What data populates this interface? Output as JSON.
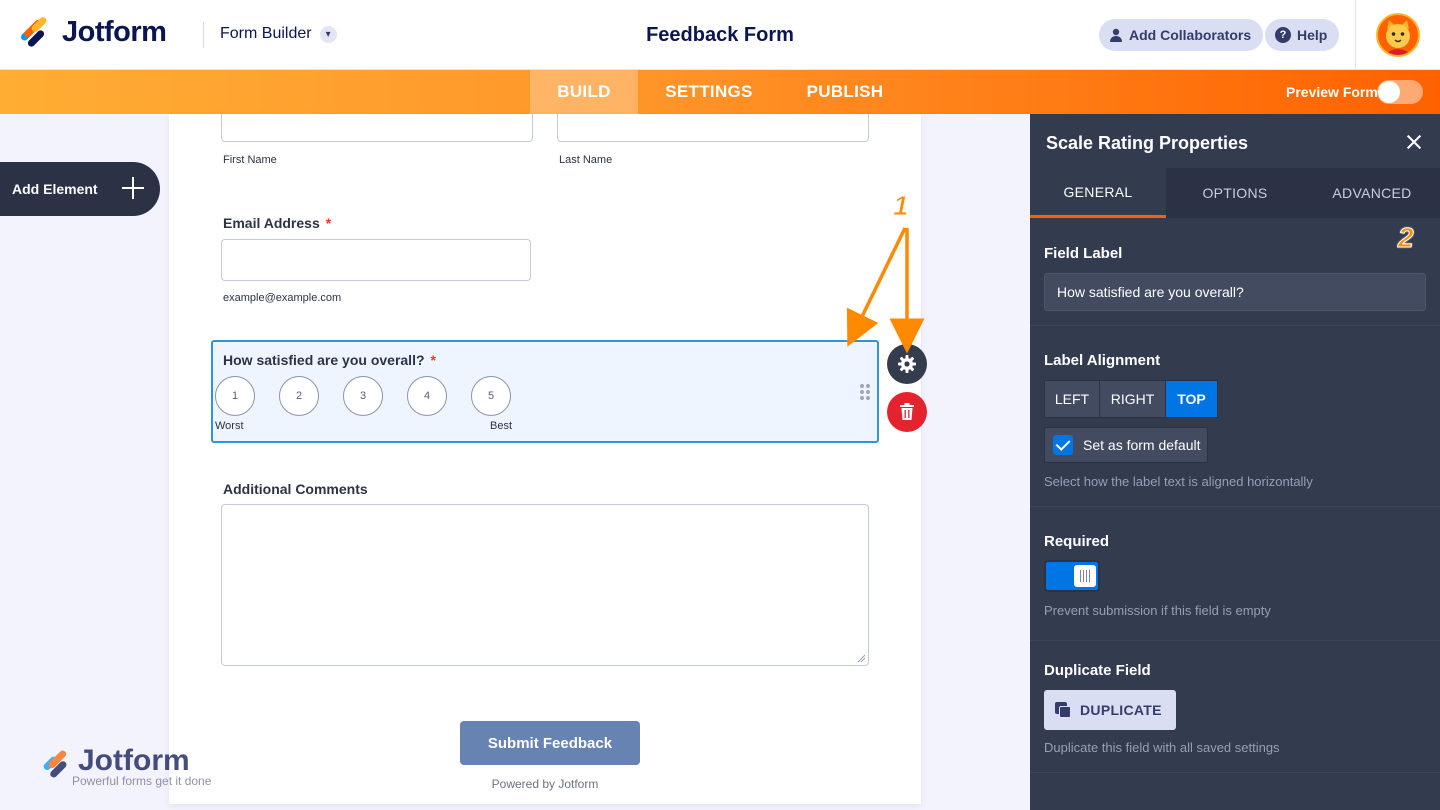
{
  "header": {
    "logo_text": "Jotform",
    "form_builder_label": "Form Builder",
    "form_title": "Feedback Form",
    "add_collaborators_label": "Add Collaborators",
    "help_label": "Help",
    "help_icon_char": "?"
  },
  "nav": {
    "tabs": [
      {
        "label": "BUILD",
        "active": true
      },
      {
        "label": "SETTINGS",
        "active": false
      },
      {
        "label": "PUBLISH",
        "active": false
      }
    ],
    "preview_label": "Preview Form",
    "preview_on": false
  },
  "canvas": {
    "add_element_label": "Add Element",
    "first_name_sublabel": "First Name",
    "last_name_sublabel": "Last Name",
    "email": {
      "label": "Email Address",
      "required_mark": "*",
      "sublabel": "example@example.com"
    },
    "rating": {
      "label": "How satisfied are you overall?",
      "required_mark": "*",
      "options": [
        "1",
        "2",
        "3",
        "4",
        "5"
      ],
      "worst_label": "Worst",
      "best_label": "Best"
    },
    "comments_label": "Additional Comments",
    "submit_label": "Submit Feedback",
    "powered_by": "Powered by Jotform"
  },
  "watermark": {
    "text": "Jotform",
    "tagline": "Powerful forms get it done"
  },
  "annotations": {
    "one": "1",
    "two": "2",
    "color": "#ff8a00"
  },
  "panel": {
    "title": "Scale Rating Properties",
    "tabs": [
      {
        "label": "GENERAL",
        "active": true
      },
      {
        "label": "OPTIONS",
        "active": false
      },
      {
        "label": "ADVANCED",
        "active": false
      }
    ],
    "field_label_title": "Field Label",
    "field_label_value": "How satisfied are you overall?",
    "label_alignment_title": "Label Alignment",
    "alignment_options": [
      "LEFT",
      "RIGHT",
      "TOP"
    ],
    "alignment_selected": "TOP",
    "set_default_label": "Set as form default",
    "set_default_checked": true,
    "alignment_help": "Select how the label text is aligned horizontally",
    "required_title": "Required",
    "required_on": true,
    "required_help": "Prevent submission if this field is empty",
    "duplicate_title": "Duplicate Field",
    "duplicate_button": "DUPLICATE",
    "duplicate_help": "Duplicate this field with all saved settings"
  },
  "colors": {
    "accent_orange": "#ff6100",
    "nav_gradient_start": "#ffad33",
    "selected_blue": "#0075e3",
    "panel_bg": "#333b4e",
    "submit_bg": "#6683b2",
    "delete_red": "#e3242f"
  }
}
